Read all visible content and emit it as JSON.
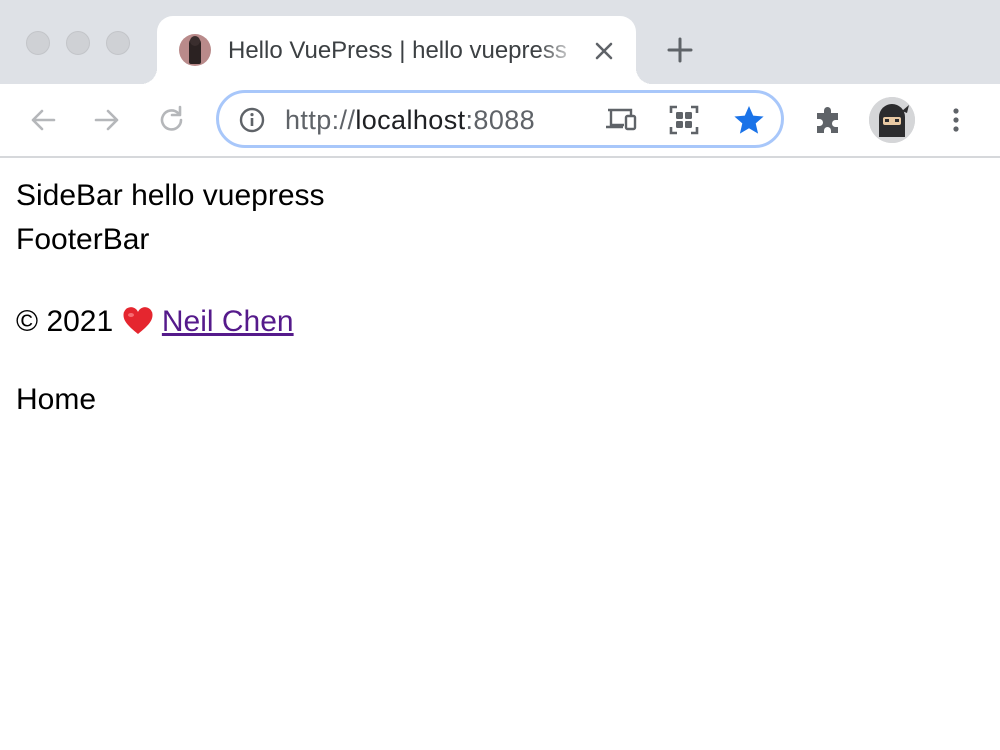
{
  "browser": {
    "tab": {
      "title": "Hello VuePress | hello vuepress"
    },
    "address_bar": {
      "url_scheme": "http://",
      "url_host": "localhost",
      "url_port": ":8088"
    },
    "colors": {
      "star_active": "#1a73e8",
      "omnibox_focus": "#a8c7fa",
      "visited_link": "#551a8b"
    }
  },
  "page": {
    "sidebar_text": "SideBar hello vuepress",
    "footerbar_text": "FooterBar",
    "copyright": {
      "prefix": "© 2021",
      "heart_icon": "red-heart",
      "author_link": "Neil Chen"
    },
    "home_text": "Home"
  }
}
